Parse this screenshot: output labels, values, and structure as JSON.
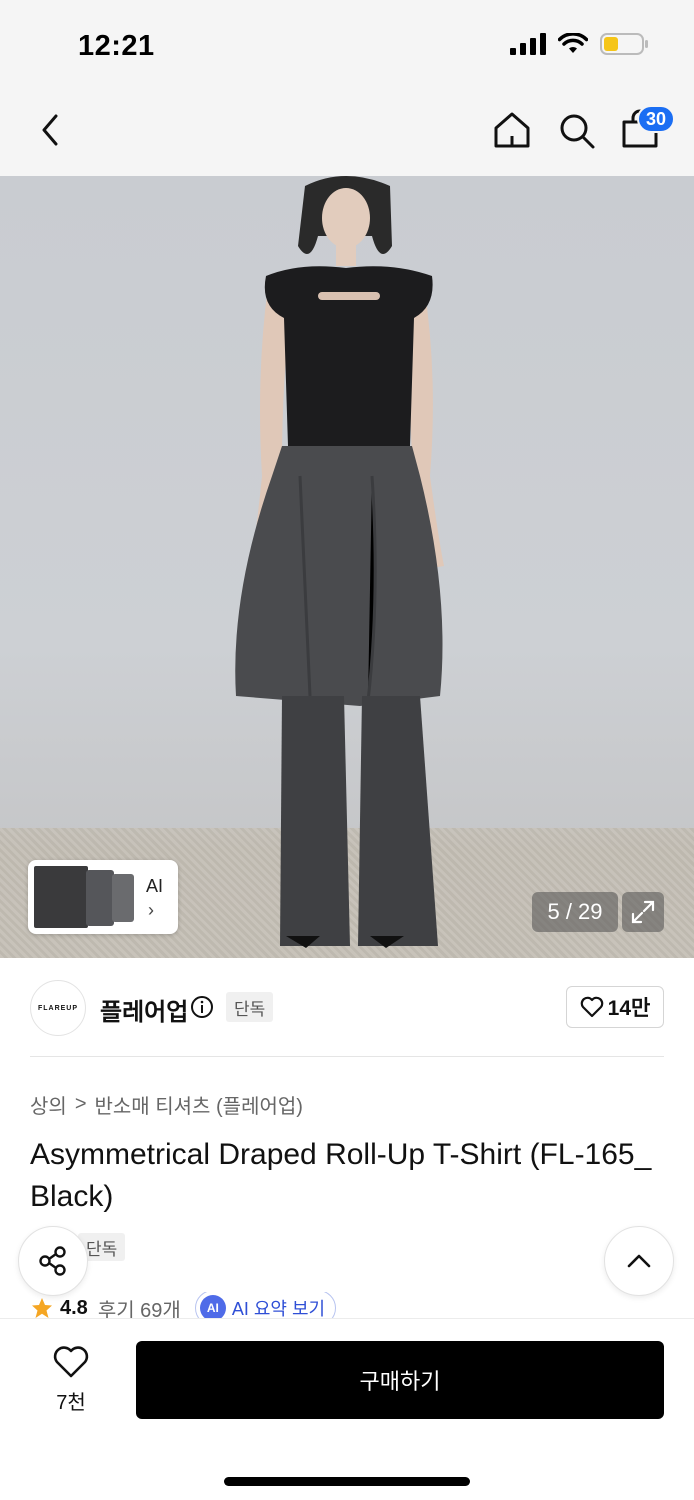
{
  "status_bar": {
    "time": "12:21"
  },
  "nav": {
    "cart_count": "30"
  },
  "gallery": {
    "ai_label": "AI",
    "ai_chevron": "›",
    "page_counter": "5 / 29"
  },
  "brand": {
    "logo_text": "FLAREUP",
    "name": "플레어업",
    "tag": "단독",
    "likes": "14만"
  },
  "breadcrumb": {
    "category": "상의",
    "separator": ">",
    "subcategory": "반소매 티셔츠 (플레어업)"
  },
  "product": {
    "title": "Asymmetrical Draped Roll-Up T-Shirt (FL-165_Black)",
    "exclusive_tag": "단독",
    "rating": "4.8",
    "review_label": "후기 69개",
    "ai_badge": "AI",
    "ai_summary_label": "AI 요약 보기"
  },
  "bottom": {
    "wish_count": "7천",
    "buy_label": "구매하기"
  },
  "colors": {
    "accent_blue": "#1b6ef3",
    "buy_button": "#000000",
    "star": "#f5a623"
  },
  "icons": [
    "back-icon",
    "home-icon",
    "search-icon",
    "cart-icon",
    "expand-icon",
    "info-icon",
    "heart-icon",
    "share-icon",
    "chevron-up-icon",
    "star-icon"
  ]
}
